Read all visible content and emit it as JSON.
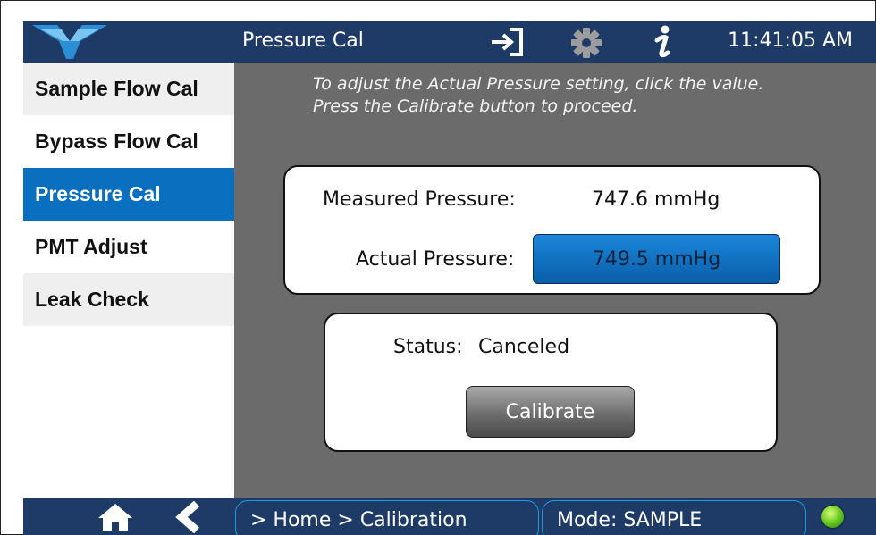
{
  "header": {
    "title": "Pressure Cal",
    "time": "11:41:05 AM",
    "icons": [
      "teledyne-logo",
      "sign-in-icon",
      "gear-icon",
      "info-icon"
    ]
  },
  "sidebar": {
    "items": [
      {
        "label": "Sample Flow Cal",
        "active": false
      },
      {
        "label": "Bypass Flow Cal",
        "active": false
      },
      {
        "label": "Pressure Cal",
        "active": true
      },
      {
        "label": "PMT Adjust",
        "active": false
      },
      {
        "label": "Leak Check",
        "active": false
      }
    ]
  },
  "instructions": {
    "line1": "To adjust the Actual Pressure setting, click the value.",
    "line2": "Press the Calibrate button to proceed."
  },
  "pressure": {
    "measured_label": "Measured Pressure:",
    "measured_value": "747.6 mmHg",
    "actual_label": "Actual Pressure:",
    "actual_value": "749.5 mmHg"
  },
  "status": {
    "label": "Status:",
    "value": "Canceled",
    "button": "Calibrate"
  },
  "footer": {
    "breadcrumb": "> Home > Calibration",
    "mode": "Mode: SAMPLE",
    "icons": [
      "home-icon",
      "back-icon",
      "status-led"
    ]
  },
  "colors": {
    "header": "#1e3a66",
    "active": "#0a6fbf",
    "background": "#6b6b6b",
    "accent_border": "#1a9be0"
  }
}
